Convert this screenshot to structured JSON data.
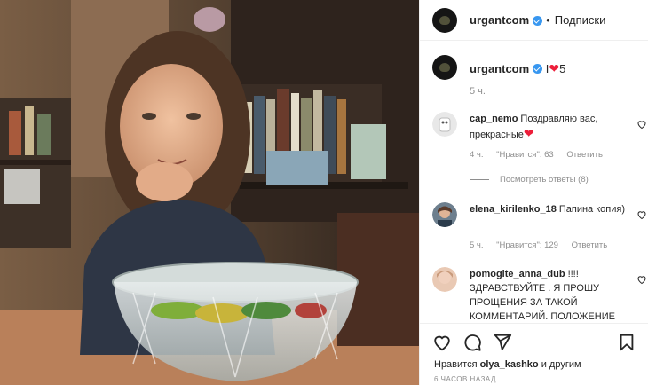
{
  "post": {
    "username": "urgantcom",
    "follow_label": "Подписки",
    "caption_text": "I",
    "caption_suffix": "5",
    "caption_time": "5 ч."
  },
  "comments": [
    {
      "username": "cap_nemo",
      "text": "Поздравляю вас, прекрасные",
      "time": "4 ч.",
      "likes": "\"Нравится\": 63",
      "reply": "Ответить",
      "view_replies": "Посмотреть ответы (8)"
    },
    {
      "username": "elena_kirilenko_18",
      "text": "Папина копия)",
      "time": "5 ч.",
      "likes": "\"Нравится\": 129",
      "reply": "Ответить"
    },
    {
      "username": "pomogite_anna_dub",
      "text": "!!!! ЗДРАВСТВУЙТЕ . Я ПРОШУ ПРОЩЕНИЯ ЗА ТАКОЙ КОММЕНТАРИЙ. ПОЛОЖЕНИЕ"
    }
  ],
  "footer": {
    "likes_prefix": "Нравится",
    "likes_user": "olya_kashko",
    "likes_suffix": "и другим",
    "timestamp": "6 ЧАСОВ НАЗАД"
  },
  "colors": {
    "verified": "#3897f0",
    "heart": "#ed1e3a",
    "muted_text": "#8e8e8e"
  },
  "icons": [
    "verified-icon",
    "heart-outline-icon",
    "comment-icon",
    "share-icon",
    "bookmark-icon",
    "red-heart-emoji"
  ]
}
